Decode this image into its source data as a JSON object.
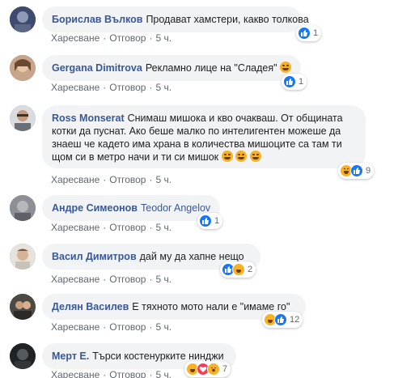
{
  "actions": {
    "like": "Харесване",
    "reply": "Отговор"
  },
  "comments": [
    {
      "author": "Борислав Вълков",
      "text": "Продават хамстери, какво толкова",
      "time": "5 ч.",
      "reaction_count": "1"
    },
    {
      "author": "Gergana Dimitrova",
      "text": "Рекламно лице на \"Сладея\"",
      "time": "5 ч.",
      "reaction_count": "1"
    },
    {
      "author": "Ross Monserat",
      "line1": "Снимаш мишока и кво очакваш. От общината",
      "line2": "котки да пуснат. Ако беше малко по интелигентен можеше да",
      "line3": "знаеш че кадето има храна в количества мишоците са там ти",
      "line4": "щом си в метро начи и ти си мишок",
      "time": "5 ч.",
      "reaction_count": "9"
    },
    {
      "author": "Андре Симеонов",
      "mention": "Teodor Angelov",
      "time": "5 ч.",
      "reaction_count": "1"
    },
    {
      "author": "Васил Димитров",
      "text": "дай му да хапне нещо",
      "time": "5 ч.",
      "reaction_count": "2"
    },
    {
      "author": "Делян Василев",
      "text": "Е тяхното мото нали е \"имаме го\"",
      "time": "5 ч.",
      "reaction_count": "12"
    },
    {
      "author": "Мерт Е.",
      "text": "Търси костенурките нинджи",
      "time": "5 ч.",
      "reaction_count": "7"
    }
  ],
  "colors": {
    "author": "#385898",
    "bubble": "#f2f3f5",
    "like": "#1877f2",
    "haha": "#f7b125",
    "love": "#f33e58"
  }
}
